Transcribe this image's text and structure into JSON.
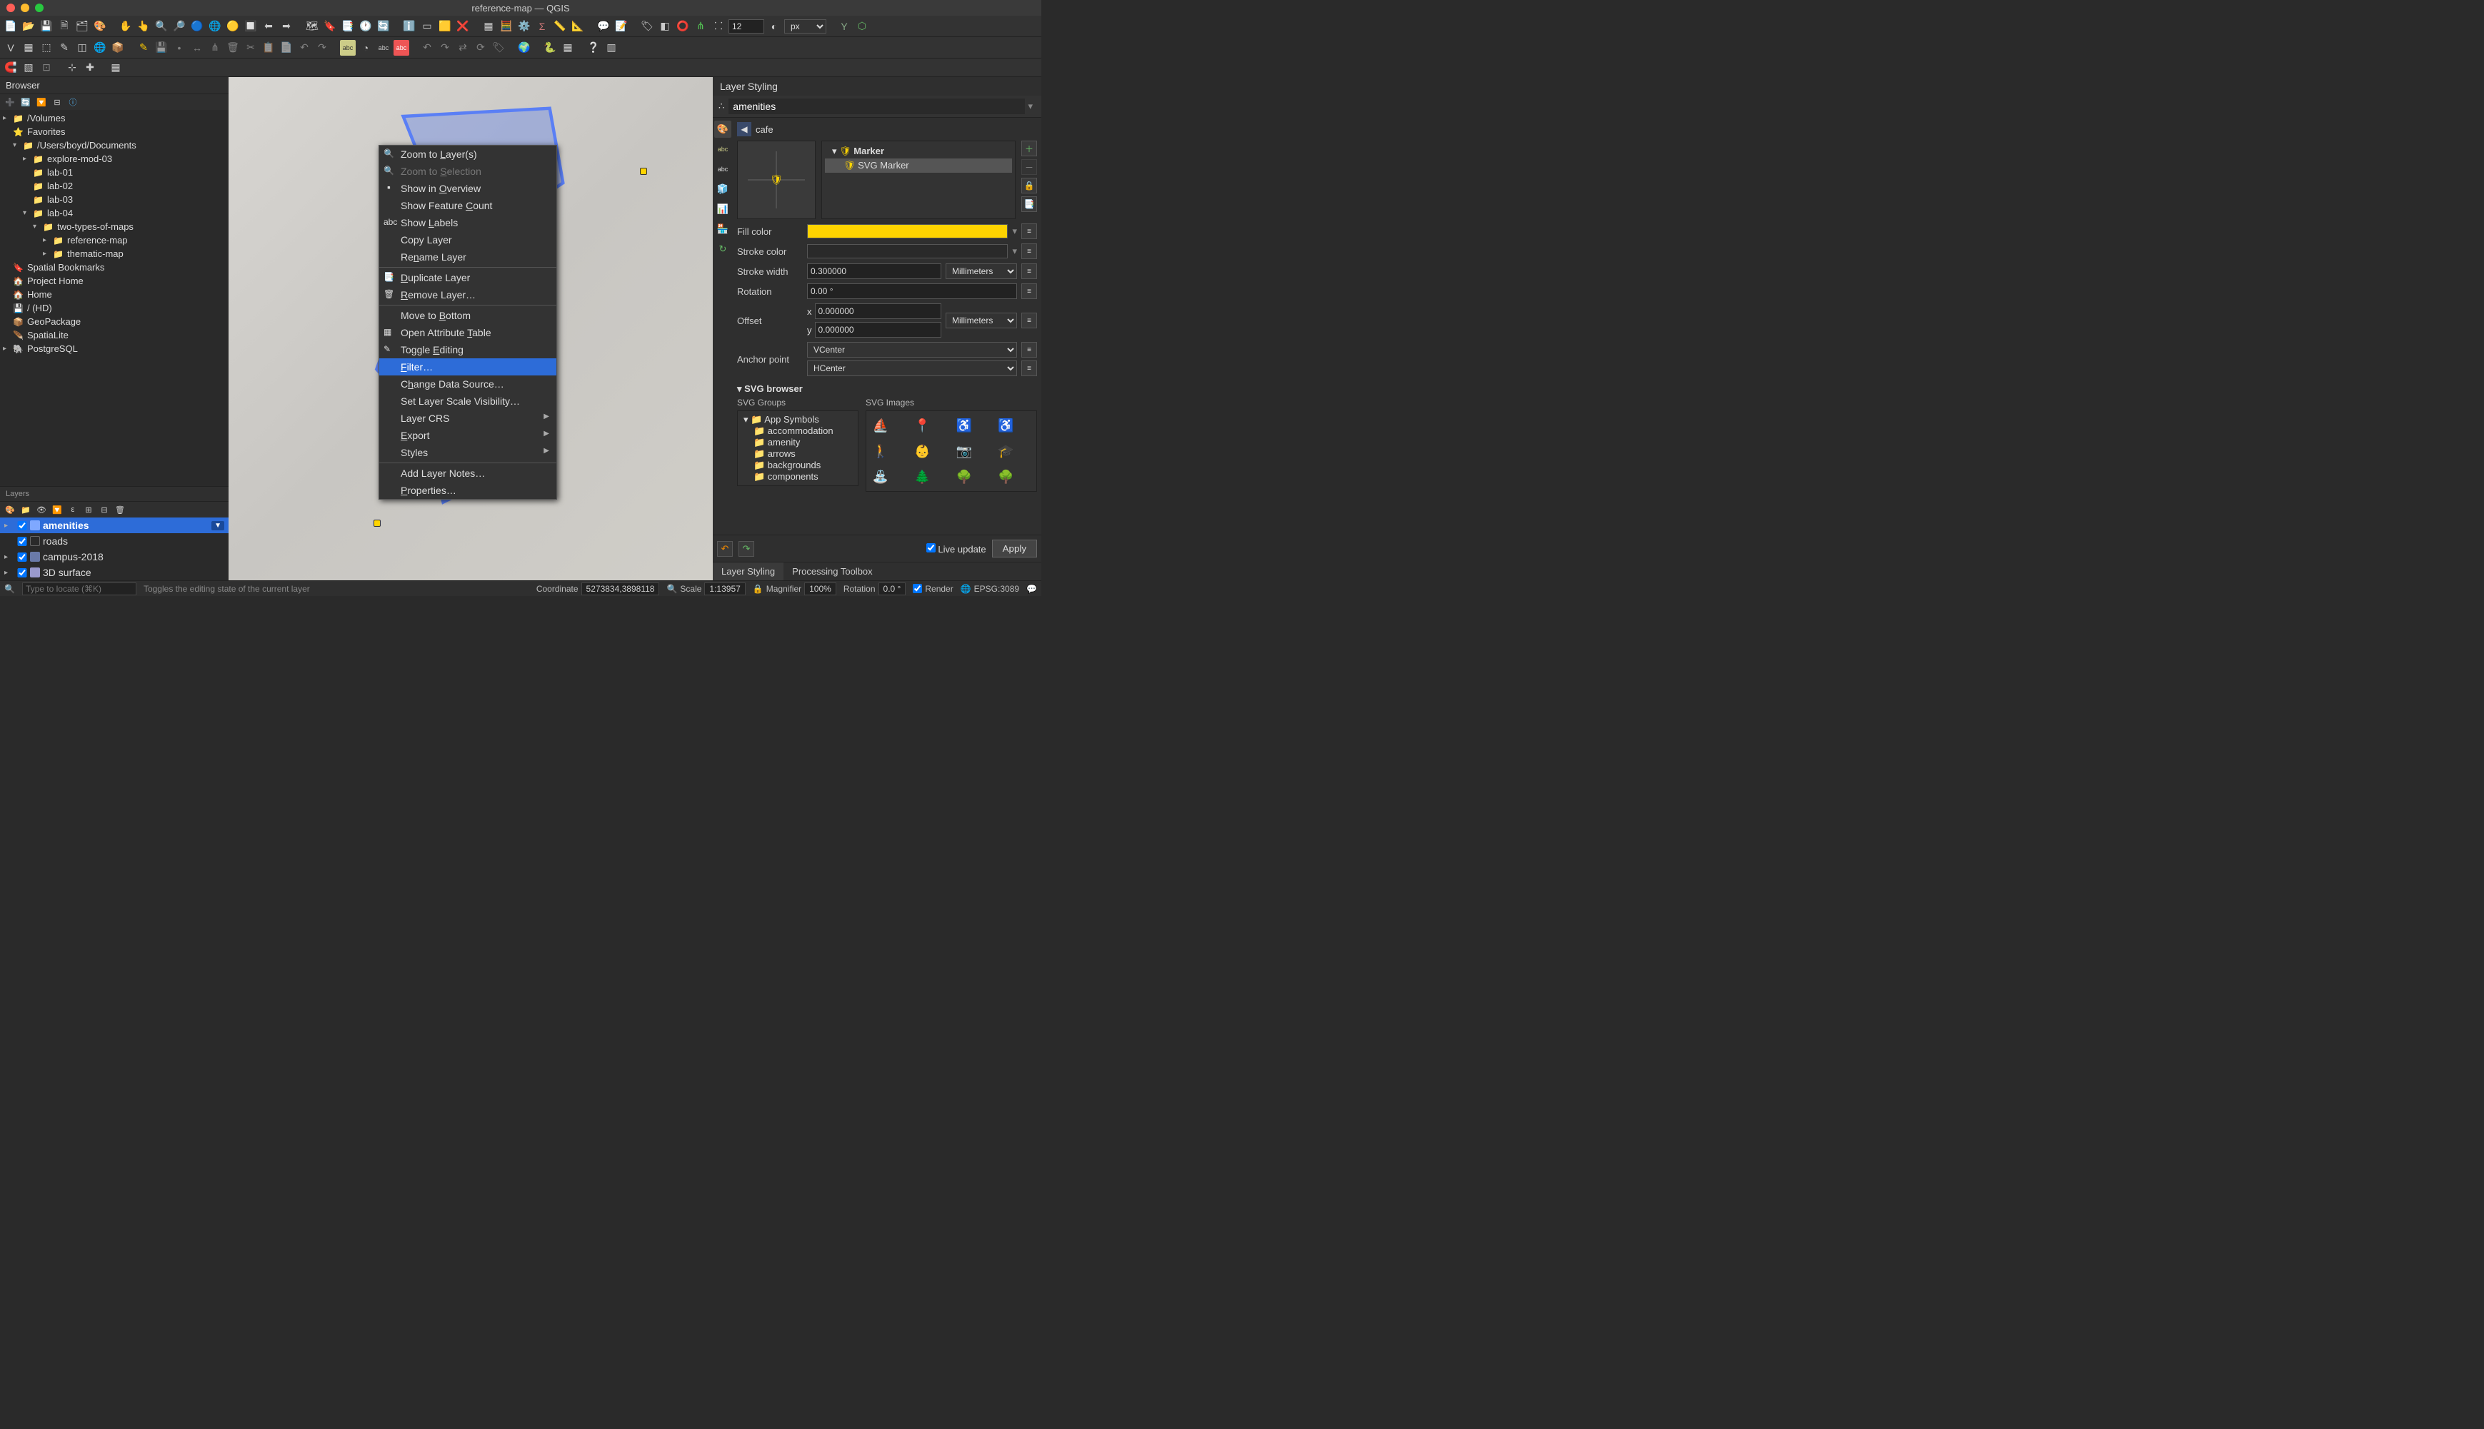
{
  "window_title": "reference-map — QGIS",
  "toolbar_font_size": "12",
  "toolbar_unit": "px",
  "browser": {
    "title": "Browser",
    "tree": [
      {
        "d": 0,
        "arrow": "▸",
        "icon": "📁",
        "label": "/Volumes"
      },
      {
        "d": 0,
        "arrow": "",
        "icon": "⭐",
        "label": "Favorites"
      },
      {
        "d": 1,
        "arrow": "▾",
        "icon": "📁",
        "label": "/Users/boyd/Documents"
      },
      {
        "d": 2,
        "arrow": "▸",
        "icon": "📁",
        "label": "explore-mod-03"
      },
      {
        "d": 2,
        "arrow": "",
        "icon": "📁",
        "label": "lab-01"
      },
      {
        "d": 2,
        "arrow": "",
        "icon": "📁",
        "label": "lab-02"
      },
      {
        "d": 2,
        "arrow": "",
        "icon": "📁",
        "label": "lab-03"
      },
      {
        "d": 2,
        "arrow": "▾",
        "icon": "📁",
        "label": "lab-04"
      },
      {
        "d": 3,
        "arrow": "▾",
        "icon": "📁",
        "label": "two-types-of-maps"
      },
      {
        "d": 4,
        "arrow": "▸",
        "icon": "📁",
        "label": "reference-map"
      },
      {
        "d": 4,
        "arrow": "▸",
        "icon": "📁",
        "label": "thematic-map"
      },
      {
        "d": 0,
        "arrow": "",
        "icon": "🔖",
        "label": "Spatial Bookmarks"
      },
      {
        "d": 0,
        "arrow": "",
        "icon": "🏠",
        "label": "Project Home"
      },
      {
        "d": 0,
        "arrow": "",
        "icon": "🏠",
        "label": "Home"
      },
      {
        "d": 0,
        "arrow": "",
        "icon": "💾",
        "label": "/ (HD)"
      },
      {
        "d": 0,
        "arrow": "",
        "icon": "📦",
        "label": "GeoPackage"
      },
      {
        "d": 0,
        "arrow": "",
        "icon": "🪶",
        "label": "SpatiaLite"
      },
      {
        "d": 0,
        "arrow": "▸",
        "icon": "🐘",
        "label": "PostgreSQL"
      }
    ]
  },
  "layers": {
    "title": "Layers",
    "items": [
      {
        "checked": true,
        "swatch": "#7fa8ff",
        "label": "amenities",
        "selected": true,
        "hasFilter": true,
        "expandable": true
      },
      {
        "checked": true,
        "swatch": null,
        "label": "roads",
        "selected": false,
        "expandable": false
      },
      {
        "checked": true,
        "swatch": "#6a7aa8",
        "label": "campus-2018",
        "selected": false,
        "expandable": true
      },
      {
        "checked": true,
        "swatch": "#9999cc",
        "label": "3D surface",
        "selected": false,
        "expandable": true
      }
    ]
  },
  "context_menu": [
    {
      "type": "item",
      "label": "Zoom to Layer(s)",
      "icon": "🔍",
      "u": [
        8
      ]
    },
    {
      "type": "item",
      "label": "Zoom to Selection",
      "icon": "🔍",
      "disabled": true,
      "u": [
        8
      ]
    },
    {
      "type": "item",
      "label": "Show in Overview",
      "icon": "▫️",
      "u": [
        8
      ]
    },
    {
      "type": "item",
      "label": "Show Feature Count",
      "u": [
        13
      ]
    },
    {
      "type": "item",
      "label": "Show Labels",
      "icon": "abc",
      "u": [
        5
      ]
    },
    {
      "type": "item",
      "label": "Copy Layer"
    },
    {
      "type": "item",
      "label": "Rename Layer",
      "u": [
        2
      ]
    },
    {
      "type": "sep"
    },
    {
      "type": "item",
      "label": "Duplicate Layer",
      "icon": "📑",
      "u": [
        0
      ]
    },
    {
      "type": "item",
      "label": "Remove Layer…",
      "icon": "🗑",
      "u": [
        0
      ]
    },
    {
      "type": "sep"
    },
    {
      "type": "item",
      "label": "Move to Bottom",
      "u": [
        8
      ]
    },
    {
      "type": "item",
      "label": "Open Attribute Table",
      "icon": "▦",
      "u": [
        15
      ]
    },
    {
      "type": "item",
      "label": "Toggle Editing",
      "icon": "✎",
      "u": [
        7
      ]
    },
    {
      "type": "item",
      "label": "Filter…",
      "highlighted": true,
      "u": [
        0
      ]
    },
    {
      "type": "item",
      "label": "Change Data Source…",
      "u": [
        1
      ]
    },
    {
      "type": "item",
      "label": "Set Layer Scale Visibility…"
    },
    {
      "type": "item",
      "label": "Layer CRS",
      "sub": true
    },
    {
      "type": "item",
      "label": "Export",
      "sub": true,
      "u": [
        0
      ]
    },
    {
      "type": "item",
      "label": "Styles",
      "sub": true
    },
    {
      "type": "sep"
    },
    {
      "type": "item",
      "label": "Add Layer Notes…"
    },
    {
      "type": "item",
      "label": "Properties…",
      "u": [
        0
      ]
    }
  ],
  "layer_styling": {
    "title": "Layer Styling",
    "layer": "amenities",
    "sublayer": "cafe",
    "symbol_tree": [
      {
        "label": "Marker",
        "bold": true,
        "d": 0
      },
      {
        "label": "SVG Marker",
        "selected": true,
        "d": 1
      }
    ],
    "props": {
      "fill_label": "Fill color",
      "fill_color": "#ffd400",
      "stroke_label": "Stroke color",
      "stroke_color": "#2a2a2a",
      "stroke_width_label": "Stroke width",
      "stroke_width": "0.300000",
      "stroke_unit": "Millimeters",
      "rotation_label": "Rotation",
      "rotation": "0.00 °",
      "offset_label": "Offset",
      "offset_x_label": "x",
      "offset_x": "0.000000",
      "offset_y_label": "y",
      "offset_y": "0.000000",
      "offset_unit": "Millimeters",
      "anchor_label": "Anchor point",
      "anchor_v": "VCenter",
      "anchor_h": "HCenter"
    },
    "svg_browser": {
      "title": "SVG browser",
      "groups_title": "SVG Groups",
      "images_title": "SVG Images",
      "groups": [
        {
          "label": "App Symbols",
          "d": 0,
          "arrow": "▾"
        },
        {
          "label": "accommodation",
          "d": 1
        },
        {
          "label": "amenity",
          "d": 1
        },
        {
          "label": "arrows",
          "d": 1
        },
        {
          "label": "backgrounds",
          "d": 1
        },
        {
          "label": "components",
          "d": 1
        }
      ],
      "images": [
        "⛵",
        "📍",
        "♿",
        "♿",
        "🚶",
        "👶",
        "📷",
        "🎓",
        "⛲",
        "🌲",
        "🌳",
        "🌳"
      ]
    },
    "live_update_label": "Live update",
    "apply_label": "Apply"
  },
  "bottom_tabs": [
    {
      "label": "Layer Styling",
      "active": true
    },
    {
      "label": "Processing Toolbox",
      "active": false
    }
  ],
  "statusbar": {
    "locator_placeholder": "Type to locate (⌘K)",
    "message": "Toggles the editing state of the current layer",
    "coord_label": "Coordinate",
    "coord": "5273834,3898118",
    "scale_label": "Scale",
    "scale": "1:13957",
    "magnifier_label": "Magnifier",
    "magnifier": "100%",
    "rotation_label": "Rotation",
    "rotation": "0.0 °",
    "render_label": "Render",
    "epsg": "EPSG:3089"
  }
}
